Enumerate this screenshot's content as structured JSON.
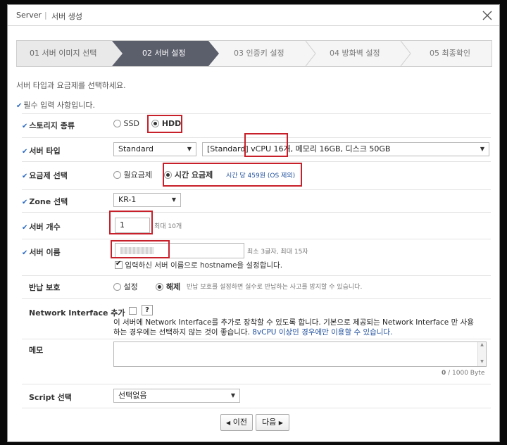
{
  "window": {
    "title": "Server",
    "subtitle": "서버 생성"
  },
  "steps": [
    {
      "label": "01 서버 이미지 선택",
      "state": "done"
    },
    {
      "label": "02 서버 설정",
      "state": "active"
    },
    {
      "label": "03 인증키 설정",
      "state": "pending"
    },
    {
      "label": "04 방화벽 설정",
      "state": "pending"
    },
    {
      "label": "05 최종확인",
      "state": "pending"
    }
  ],
  "hint": "서버 타입과 요금제를 선택하세요.",
  "required_note": "필수 입력 사항입니다.",
  "storage": {
    "label": "스토리지 종류",
    "options": [
      "SSD",
      "HDD"
    ],
    "selected": "HDD"
  },
  "server_type": {
    "label": "서버 타입",
    "type_value": "Standard",
    "spec_prefix": "[Standard]",
    "spec_cpu": "vCPU 16개",
    "spec_rest": ", 메모리 16GB, 디스크 50GB"
  },
  "plan": {
    "label": "요금제 선택",
    "options": [
      "월요금제",
      "시간 요금제"
    ],
    "selected": "시간 요금제",
    "price_note": "시간 당 459원 (OS 제외)"
  },
  "zone": {
    "label": "Zone 선택",
    "value": "KR-1"
  },
  "count": {
    "label": "서버 개수",
    "value": "1",
    "max_note": "최대 10개"
  },
  "name": {
    "label": "서버 이름",
    "value": "",
    "rule_note": "최소 3글자, 최대 15자",
    "hostname_check": "입력하신 서버 이름으로 hostname을 설정합니다."
  },
  "protect": {
    "label": "반납 보호",
    "options": [
      "설정",
      "해제"
    ],
    "selected": "해제",
    "note": "반납 보호를 설정하면 실수로 반납하는 사고를 방지할 수 있습니다."
  },
  "nic": {
    "label": "Network Interface 추가",
    "help": "?",
    "desc_1": "이 서버에 Network Interface를 추가로 장착할 수 있도록 합니다. 기본으로 제공되는 Network Interface 만 사용",
    "desc_2": "하는 경우에는 선택하지 않는 것이 좋습니다. ",
    "desc_highlight": "8vCPU 이상인 경우에만 이용할 수 있습니다."
  },
  "memo": {
    "label": "메모",
    "count": "0",
    "limit": "/ 1000 Byte"
  },
  "script": {
    "label": "Script 선택",
    "value": "선택없음"
  },
  "buttons": {
    "prev": "이전",
    "next": "다음"
  },
  "colors": {
    "active_step": "#5b5e6b",
    "highlight": "#c8202a",
    "link_blue": "#1f4f9c"
  }
}
